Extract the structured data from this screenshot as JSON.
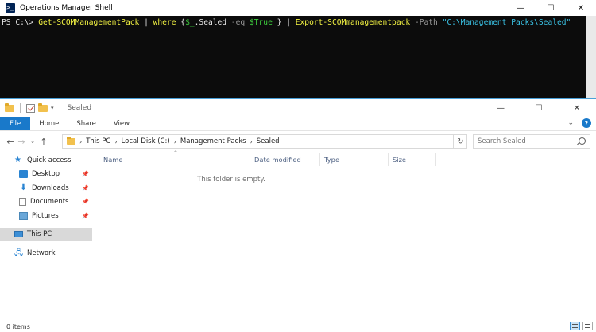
{
  "powershell": {
    "title": "Operations Manager Shell",
    "controls": {
      "minimize": "—",
      "maximize": "☐",
      "close": "✕"
    },
    "command": {
      "prompt": "PS C:\\> ",
      "cmd1": "Get-SCOMManagementPack",
      "pipe1": " | ",
      "cmd2": "where",
      "brace_open": " {",
      "var": "$_",
      "prop": ".Sealed",
      "op": " -eq ",
      "val": "$True",
      "brace_close": " }",
      "pipe2": " | ",
      "cmd3": "Export-SCOMmanagementpack",
      "param": " -Path ",
      "path": "\"C:\\Management Packs\\Sealed\""
    }
  },
  "explorer": {
    "title": "Sealed",
    "controls": {
      "minimize": "—",
      "maximize": "☐",
      "close": "✕"
    },
    "ribbon": {
      "tabs": [
        "File",
        "Home",
        "Share",
        "View"
      ]
    },
    "breadcrumb": [
      "This PC",
      "Local Disk (C:)",
      "Management Packs",
      "Sealed"
    ],
    "search": {
      "placeholder": "Search Sealed"
    },
    "sidebar": {
      "quick_access": "Quick access",
      "items": [
        "Desktop",
        "Downloads",
        "Documents",
        "Pictures"
      ],
      "this_pc": "This PC",
      "network": "Network"
    },
    "columns": [
      "Name",
      "Date modified",
      "Type",
      "Size"
    ],
    "empty_message": "This folder is empty.",
    "status": "0 items"
  },
  "colors": {
    "console_bg": "#0c0c0c",
    "accent": "#1979ca",
    "column_header": "#4d6082"
  }
}
